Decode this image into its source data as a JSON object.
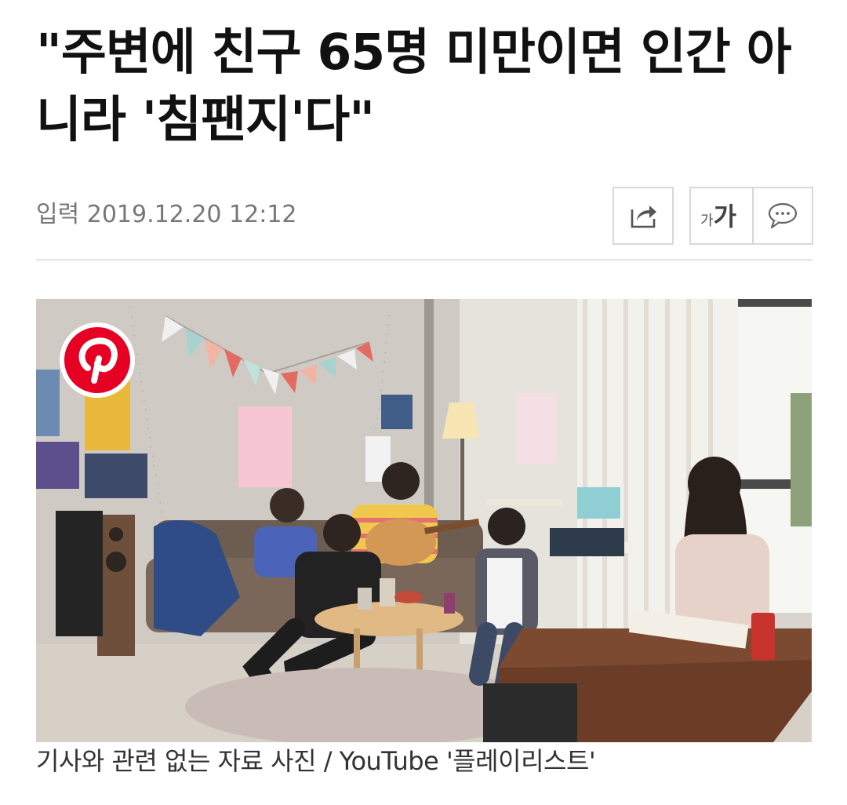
{
  "article": {
    "title": "\"주변에 친구 65명 미만이면 인간 아니라 '침팬지'다\"",
    "date": "입력 2019.12.20 12:12"
  },
  "toolbar": {
    "share_icon": "share-icon",
    "font_size_small": "가",
    "font_size_large": "가",
    "comment_icon": "comment-icon"
  },
  "photo": {
    "pin_icon": "pinterest-icon",
    "caption": "기사와 관련 없는 자료 사진 / YouTube '플레이리스트'"
  },
  "colors": {
    "pinterest_red": "#e60023",
    "divider": "#e2e2e2",
    "border": "#d8d8d8",
    "date_text": "#777777"
  }
}
